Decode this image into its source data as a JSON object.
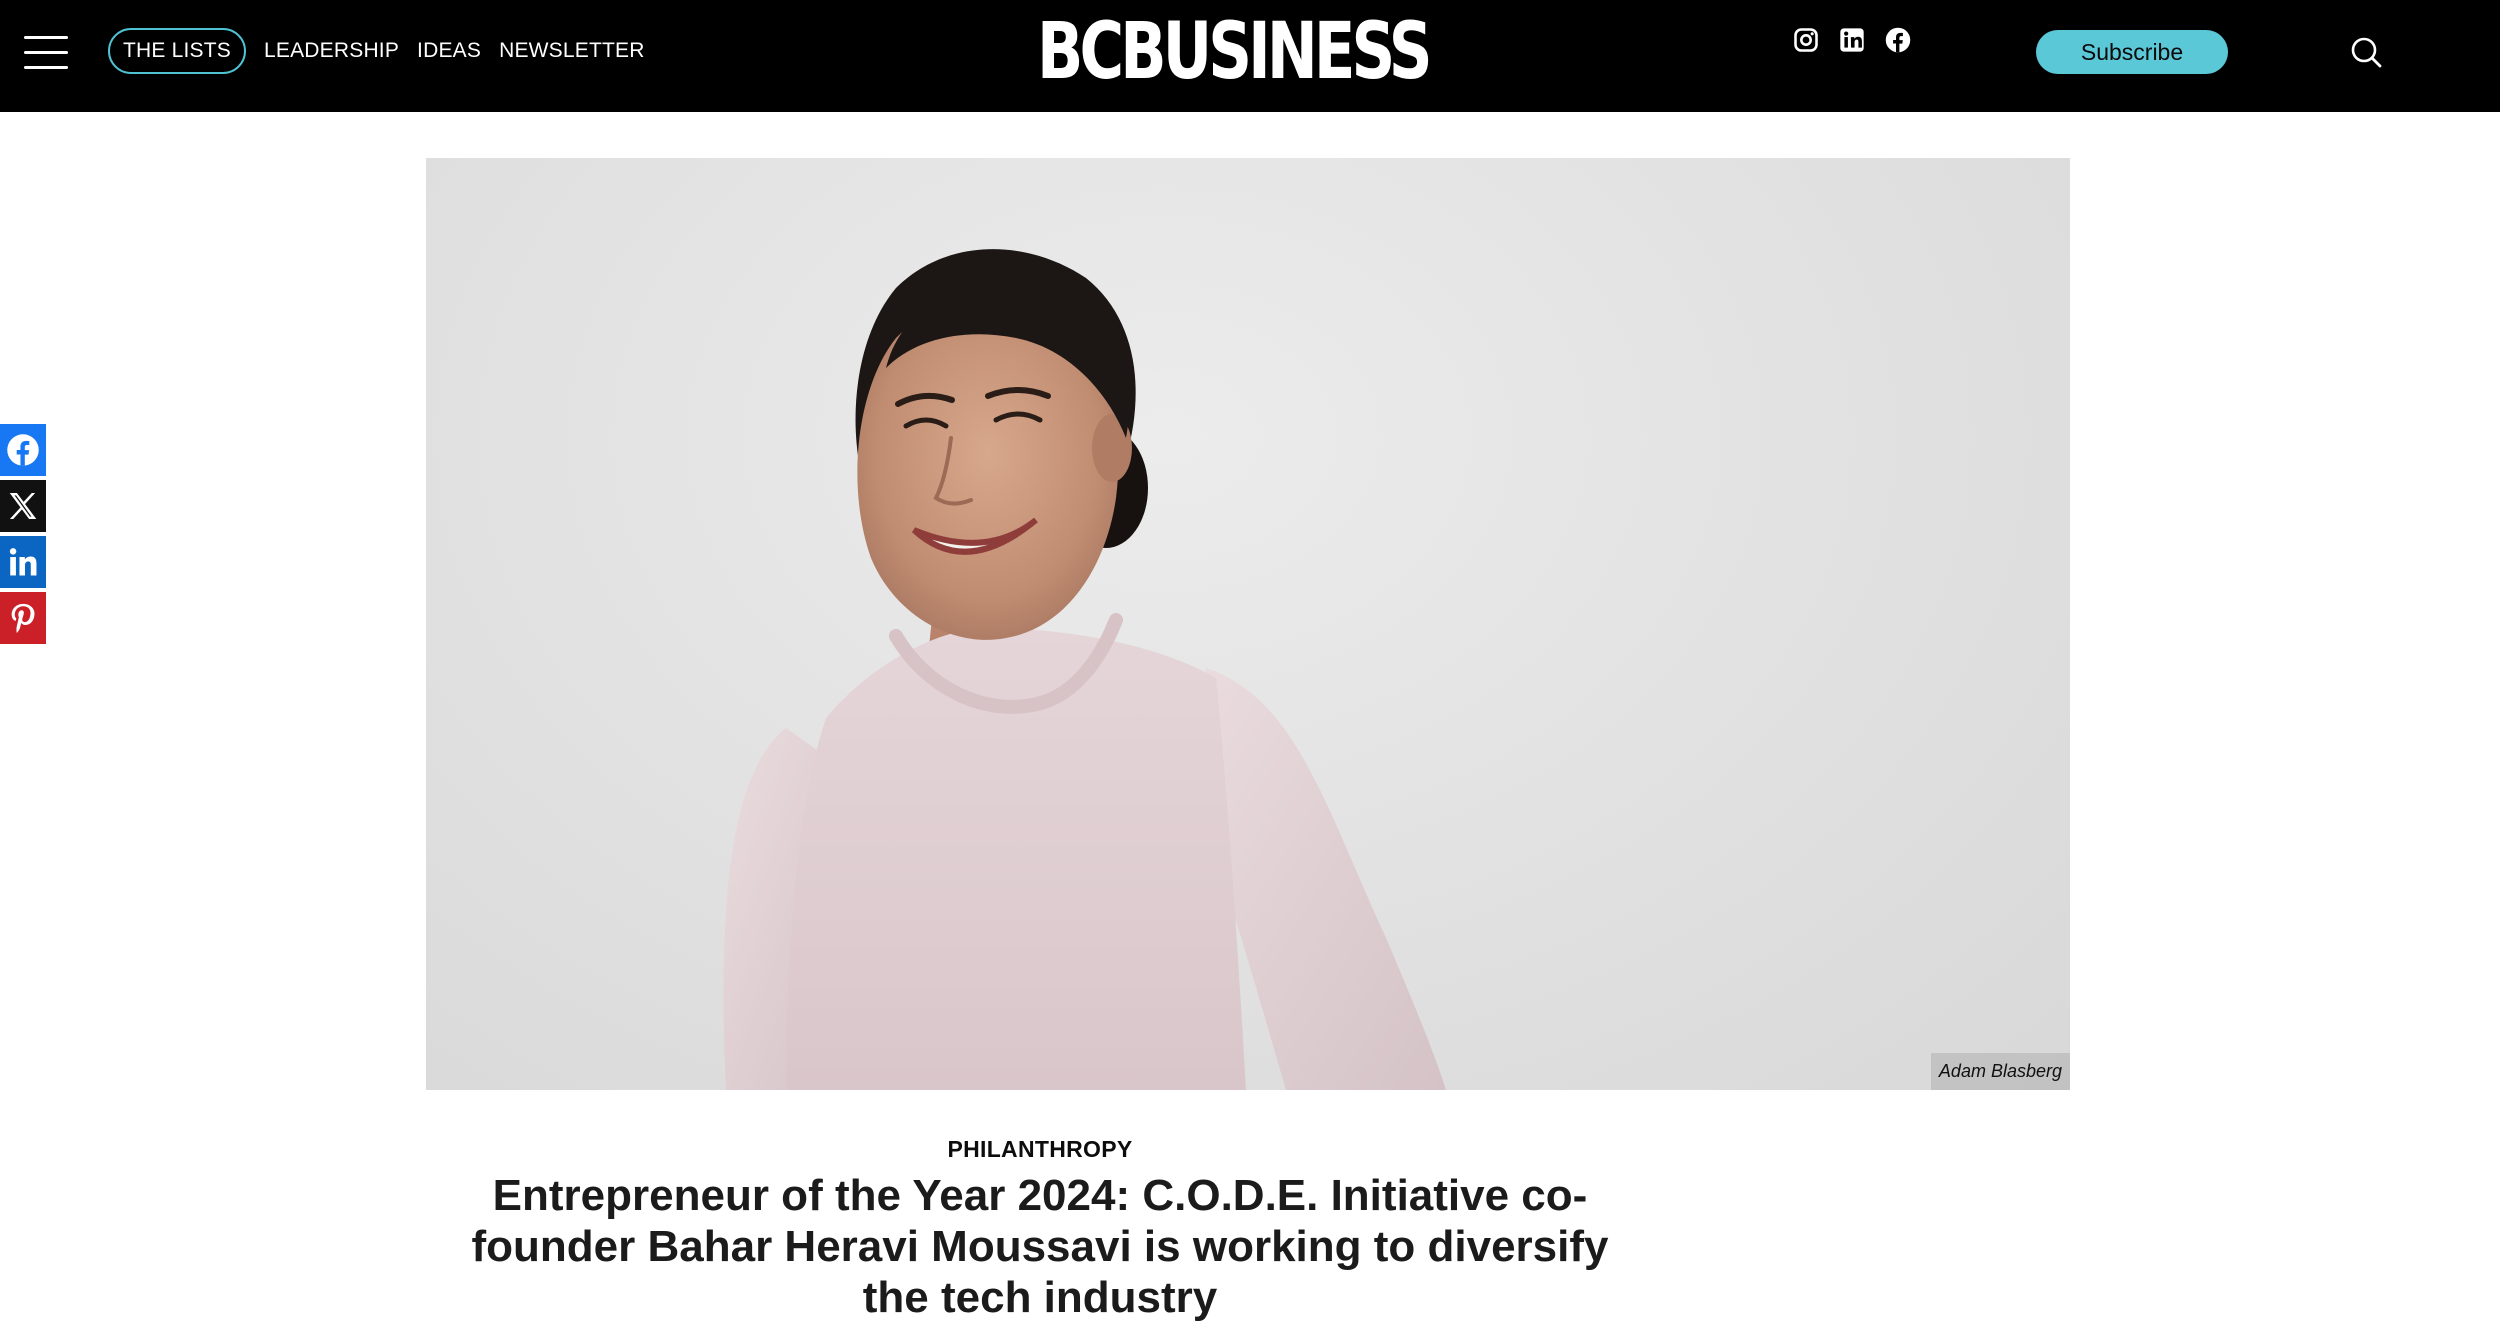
{
  "header": {
    "logo_text": "BCBUSINESS",
    "nav": [
      "THE LISTS",
      "LEADERSHIP",
      "IDEAS",
      "NEWSLETTER"
    ],
    "subscribe_label": "Subscribe",
    "social_icons": [
      "instagram-icon",
      "linkedin-icon",
      "facebook-icon"
    ]
  },
  "share_rail": [
    "facebook-share",
    "x-share",
    "linkedin-share",
    "pinterest-share"
  ],
  "hero": {
    "photo_credit": "Adam Blasberg"
  },
  "article": {
    "category": "PHILANTHROPY",
    "headline": "Entrepreneur of the Year 2024: C.O.D.E. Initiative co-founder Bahar Heravi Moussavi is working to diversify the tech industry"
  },
  "colors": {
    "accent": "#5bc8d8",
    "header_bg": "#000000"
  }
}
